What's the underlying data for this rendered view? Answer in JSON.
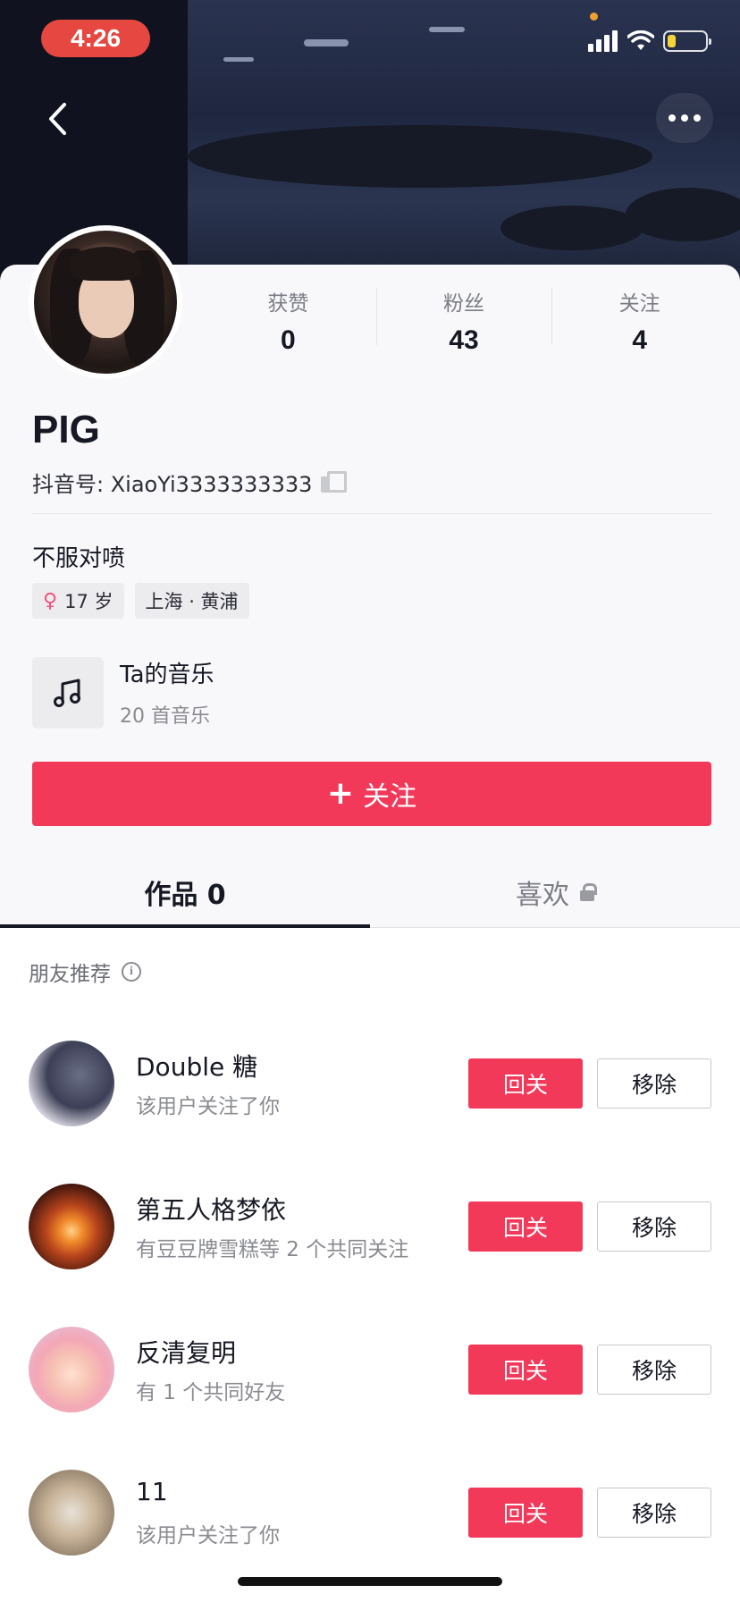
{
  "status_bar": {
    "time": "4:26",
    "battery_level_fraction": 0.2
  },
  "profile": {
    "stats": [
      {
        "label": "获赞",
        "value": "0"
      },
      {
        "label": "粉丝",
        "value": "43"
      },
      {
        "label": "关注",
        "value": "4"
      }
    ],
    "nickname": "PIG",
    "douyin_id": "抖音号: XiaoYi3333333333",
    "bio": "不服对喷",
    "tags": {
      "age": "17 岁",
      "location": "上海 · 黄浦"
    },
    "music": {
      "title": "Ta的音乐",
      "subtitle": "20 首音乐"
    },
    "follow_button": {
      "plus": "+",
      "label": "关注"
    }
  },
  "tabs": [
    {
      "label": "作品 0"
    },
    {
      "label": "喜欢"
    }
  ],
  "recommendations": {
    "header": "朋友推荐",
    "follow_back_label": "回关",
    "remove_label": "移除",
    "items": [
      {
        "name": "Double 糖",
        "desc": "该用户关注了你"
      },
      {
        "name": "第五人格梦依",
        "desc": "有豆豆牌雪糕等 2 个共同关注"
      },
      {
        "name": "反清复明",
        "desc": "有 1 个共同好友"
      },
      {
        "name": "11",
        "desc": "该用户关注了你"
      }
    ]
  },
  "colors": {
    "accent": "#f2395a",
    "time_pill": "#e64740"
  }
}
